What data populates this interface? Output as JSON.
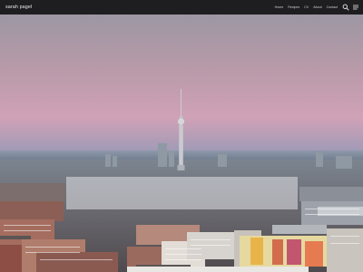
{
  "site": {
    "title": "sarah pagel"
  },
  "nav": {
    "items": [
      {
        "label": "Home"
      },
      {
        "label": "Recipes"
      },
      {
        "label": "CV"
      },
      {
        "label": "About"
      },
      {
        "label": "Contact"
      }
    ]
  },
  "icons": {
    "search": "search-icon",
    "menu": "hamburger-menu-icon"
  },
  "colors": {
    "topbar": "#1e1e20",
    "sky_top": "#a89aa0",
    "sky_mid": "#d4a3b8",
    "sky_bottom": "#6f9ab7"
  }
}
